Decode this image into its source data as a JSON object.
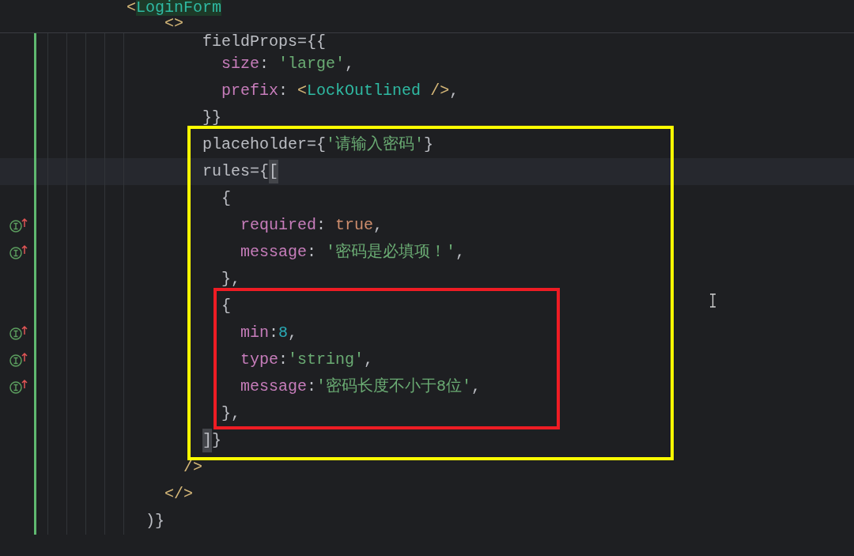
{
  "sticky_lines": [
    {
      "tokens": [
        {
          "text": "        <",
          "kind": "tag"
        },
        {
          "text": "LoginForm",
          "kind": "tagname-match"
        }
      ]
    },
    {
      "tokens": [
        {
          "text": "            <>",
          "kind": "tag"
        }
      ]
    }
  ],
  "lines": [
    {
      "marker": false,
      "current": false,
      "tokens": [
        {
          "text": "                fieldProps={{",
          "kind": "plain"
        }
      ]
    },
    {
      "marker": false,
      "current": false,
      "tokens": [
        {
          "text": "                  size",
          "kind": "key"
        },
        {
          "text": ": ",
          "kind": "plain"
        },
        {
          "text": "'large'",
          "kind": "string"
        },
        {
          "text": ",",
          "kind": "plain"
        }
      ]
    },
    {
      "marker": false,
      "current": false,
      "tokens": [
        {
          "text": "                  prefix",
          "kind": "key"
        },
        {
          "text": ": ",
          "kind": "plain"
        },
        {
          "text": "<",
          "kind": "tag"
        },
        {
          "text": "LockOutlined",
          "kind": "tagname"
        },
        {
          "text": " />",
          "kind": "tag"
        },
        {
          "text": ",",
          "kind": "plain"
        }
      ]
    },
    {
      "marker": false,
      "current": false,
      "tokens": [
        {
          "text": "                }}",
          "kind": "plain"
        }
      ]
    },
    {
      "marker": false,
      "current": false,
      "tokens": [
        {
          "text": "                placeholder={",
          "kind": "plain"
        },
        {
          "text": "'请输入密码'",
          "kind": "string"
        },
        {
          "text": "}",
          "kind": "plain"
        }
      ]
    },
    {
      "marker": false,
      "current": true,
      "tokens": [
        {
          "text": "                rules={",
          "kind": "plain"
        },
        {
          "text": "[",
          "kind": "match"
        }
      ]
    },
    {
      "marker": false,
      "current": false,
      "tokens": [
        {
          "text": "                  {",
          "kind": "plain"
        }
      ]
    },
    {
      "marker": true,
      "current": false,
      "tokens": [
        {
          "text": "                    required",
          "kind": "key"
        },
        {
          "text": ": ",
          "kind": "plain"
        },
        {
          "text": "true",
          "kind": "keyword"
        },
        {
          "text": ",",
          "kind": "plain"
        }
      ]
    },
    {
      "marker": true,
      "current": false,
      "tokens": [
        {
          "text": "                    message",
          "kind": "key"
        },
        {
          "text": ": ",
          "kind": "plain"
        },
        {
          "text": "'密码是必填项！'",
          "kind": "string"
        },
        {
          "text": ",",
          "kind": "plain"
        }
      ]
    },
    {
      "marker": false,
      "current": false,
      "tokens": [
        {
          "text": "                  },",
          "kind": "plain"
        }
      ]
    },
    {
      "marker": false,
      "current": false,
      "tokens": [
        {
          "text": "                  {",
          "kind": "plain"
        }
      ]
    },
    {
      "marker": true,
      "current": false,
      "tokens": [
        {
          "text": "                    min",
          "kind": "key"
        },
        {
          "text": ":",
          "kind": "plain"
        },
        {
          "text": "8",
          "kind": "number"
        },
        {
          "text": ",",
          "kind": "plain"
        }
      ]
    },
    {
      "marker": true,
      "current": false,
      "tokens": [
        {
          "text": "                    type",
          "kind": "key"
        },
        {
          "text": ":",
          "kind": "plain"
        },
        {
          "text": "'string'",
          "kind": "string"
        },
        {
          "text": ",",
          "kind": "plain"
        }
      ]
    },
    {
      "marker": true,
      "current": false,
      "tokens": [
        {
          "text": "                    message",
          "kind": "key"
        },
        {
          "text": ":",
          "kind": "plain"
        },
        {
          "text": "'密码长度不小于8位'",
          "kind": "string"
        },
        {
          "text": ",",
          "kind": "plain"
        }
      ]
    },
    {
      "marker": false,
      "current": false,
      "tokens": [
        {
          "text": "                  },",
          "kind": "plain"
        }
      ]
    },
    {
      "marker": false,
      "current": false,
      "tokens": [
        {
          "text": "                ]",
          "kind": "match"
        },
        {
          "text": "}",
          "kind": "plain"
        }
      ]
    },
    {
      "marker": false,
      "current": false,
      "tokens": [
        {
          "text": "              />",
          "kind": "tag"
        }
      ]
    },
    {
      "marker": false,
      "current": false,
      "tokens": [
        {
          "text": "            </>",
          "kind": "tag"
        }
      ]
    },
    {
      "marker": false,
      "current": false,
      "tokens": [
        {
          "text": "          )}",
          "kind": "plain"
        }
      ]
    }
  ],
  "annotations": [
    {
      "color": "#ffff00"
    },
    {
      "color": "#ee1c24"
    }
  ]
}
